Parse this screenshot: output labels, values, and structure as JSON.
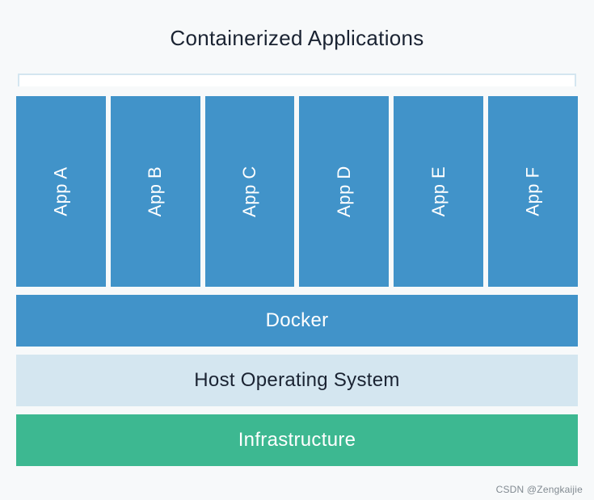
{
  "title": "Containerized Applications",
  "apps": [
    {
      "label": "App A"
    },
    {
      "label": "App B"
    },
    {
      "label": "App C"
    },
    {
      "label": "App D"
    },
    {
      "label": "App E"
    },
    {
      "label": "App F"
    }
  ],
  "layers": {
    "docker": "Docker",
    "host": "Host Operating System",
    "infrastructure": "Infrastructure"
  },
  "watermark": "CSDN @Zengkaijie",
  "colors": {
    "app_bg": "#4193c9",
    "host_bg": "#d4e6f0",
    "infra_bg": "#3db891",
    "page_bg": "#f7f9fa"
  }
}
